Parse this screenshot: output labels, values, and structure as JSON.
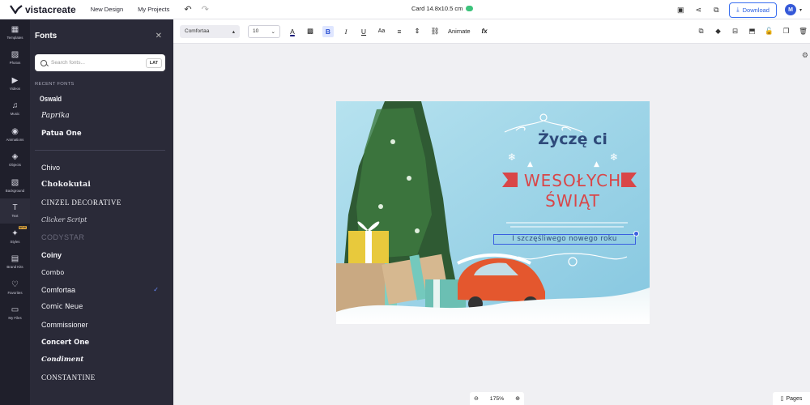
{
  "topbar": {
    "logo_text": "vistacreate",
    "nav": [
      "New Design",
      "My Projects"
    ],
    "doc_title": "Card 14.8x10.5 cm",
    "download_label": "Download",
    "avatar_initial": "M"
  },
  "rail": {
    "items": [
      {
        "label": "Templates",
        "icon": "templates-icon"
      },
      {
        "label": "Photos",
        "icon": "photos-icon"
      },
      {
        "label": "Videos",
        "icon": "videos-icon"
      },
      {
        "label": "Music",
        "icon": "music-icon"
      },
      {
        "label": "Animations",
        "icon": "animations-icon"
      },
      {
        "label": "Objects",
        "icon": "objects-icon"
      },
      {
        "label": "Background",
        "icon": "background-icon"
      },
      {
        "label": "Text",
        "icon": "text-icon"
      },
      {
        "label": "Styles",
        "icon": "styles-icon"
      },
      {
        "label": "Brand Kits",
        "icon": "brand-kits-icon"
      },
      {
        "label": "Favorites",
        "icon": "favorites-icon"
      },
      {
        "label": "My Files",
        "icon": "my-files-icon"
      }
    ],
    "new_badge": "NEW"
  },
  "panel": {
    "title": "Fonts",
    "search_placeholder": "Search fonts...",
    "lang": "LAT",
    "recent_label": "RECENT FONTS",
    "recent": [
      "Oswald",
      "Paprika",
      "Patua One"
    ],
    "fonts": [
      "Chivo",
      "Chokokutai",
      "CINZEL DECORATIVE",
      "Clicker Script",
      "CODYSTAR",
      "Coiny",
      "Combo",
      "Comfortaa",
      "Comic Neue",
      "Commissioner",
      "Concert One",
      "Condiment",
      "CONSTANTINE"
    ],
    "selected_font": "Comfortaa"
  },
  "toolbar": {
    "font": "Comfortaa",
    "size": "10",
    "animate_label": "Animate",
    "fx_label": "fx",
    "case_label": "Aa"
  },
  "card": {
    "greeting": "Życzę ci",
    "title_line1": "WESOŁYCH",
    "title_line2": "ŚWIĄT",
    "subtitle": "I szczęśliwego nowego roku",
    "colors": {
      "sky": "#9bd3e8",
      "red": "#d94648",
      "navy": "#2e4a7a"
    }
  },
  "zoom": {
    "level": "175%"
  },
  "pages_label": "Pages"
}
